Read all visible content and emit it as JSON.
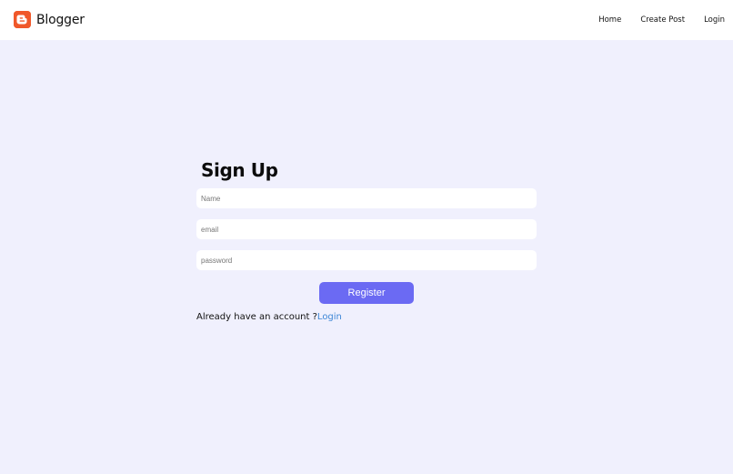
{
  "navbar": {
    "brand": "Blogger",
    "logo_icon": "blogger-logo-icon",
    "logo_color": "#f0582a",
    "links": [
      "Home",
      "Create Post",
      "Login"
    ]
  },
  "signup": {
    "title": "Sign Up",
    "fields": {
      "name_placeholder": "Name",
      "email_placeholder": "email",
      "password_placeholder": "password"
    },
    "register_label": "Register",
    "register_color": "#6b6af3",
    "account_prompt": "Already have an account ?",
    "login_link": "Login"
  },
  "colors": {
    "background": "#f0f0fd",
    "link": "#3d86d6"
  }
}
